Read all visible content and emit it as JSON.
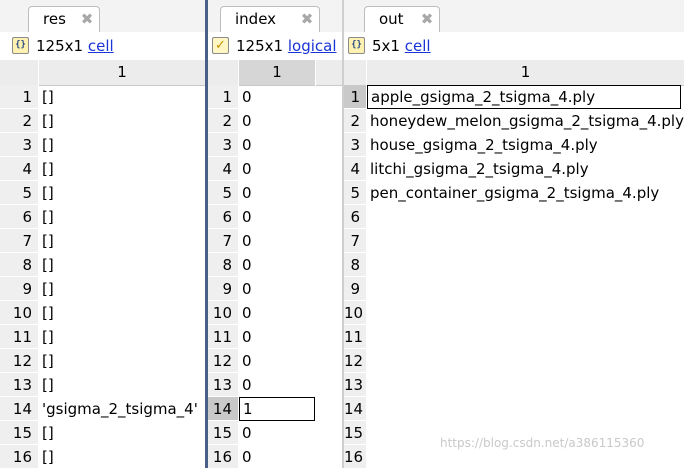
{
  "res": {
    "tab_label": "res",
    "close_glyph": "✖",
    "type_icon": "{}",
    "size": "125x1",
    "type": "cell",
    "column_header": "1",
    "row_numbers": [
      "1",
      "2",
      "3",
      "4",
      "5",
      "6",
      "7",
      "8",
      "9",
      "10",
      "11",
      "12",
      "13",
      "14",
      "15",
      "16"
    ],
    "values": [
      "[]",
      "[]",
      "[]",
      "[]",
      "[]",
      "[]",
      "[]",
      "[]",
      "[]",
      "[]",
      "[]",
      "[]",
      "[]",
      "'gsigma_2_tsigma_4'",
      "[]",
      "[]"
    ]
  },
  "index": {
    "tab_label": "index",
    "close_glyph": "✖",
    "type_icon": "✓",
    "size": "125x1",
    "type": "logical",
    "column_header": "1",
    "row_numbers": [
      "1",
      "2",
      "3",
      "4",
      "5",
      "6",
      "7",
      "8",
      "9",
      "10",
      "11",
      "12",
      "13",
      "14",
      "15",
      "16"
    ],
    "values": [
      "0",
      "0",
      "0",
      "0",
      "0",
      "0",
      "0",
      "0",
      "0",
      "0",
      "0",
      "0",
      "0",
      "1",
      "0",
      "0"
    ],
    "selected_row": 14
  },
  "out": {
    "tab_label": "out",
    "close_glyph": "✖",
    "type_icon": "{}",
    "size": "5x1",
    "type": "cell",
    "column_header": "1",
    "row_numbers": [
      "1",
      "2",
      "3",
      "4",
      "5",
      "6",
      "7",
      "8",
      "9",
      "10",
      "11",
      "12",
      "13",
      "14",
      "15",
      "16"
    ],
    "values": [
      "apple_gsigma_2_tsigma_4.ply",
      "honeydew_melon_gsigma_2_tsigma_4.ply",
      "house_gsigma_2_tsigma_4.ply",
      "litchi_gsigma_2_tsigma_4.ply",
      "pen_container_gsigma_2_tsigma_4.ply",
      "",
      "",
      "",
      "",
      "",
      "",
      "",
      "",
      "",
      "",
      ""
    ],
    "selected_row": 1
  },
  "watermark": "https://blog.csdn.net/a386115360",
  "colors": {
    "divider": "#4a5f86",
    "link": "#1a35d6",
    "selected_header": "#c9c9c9"
  }
}
